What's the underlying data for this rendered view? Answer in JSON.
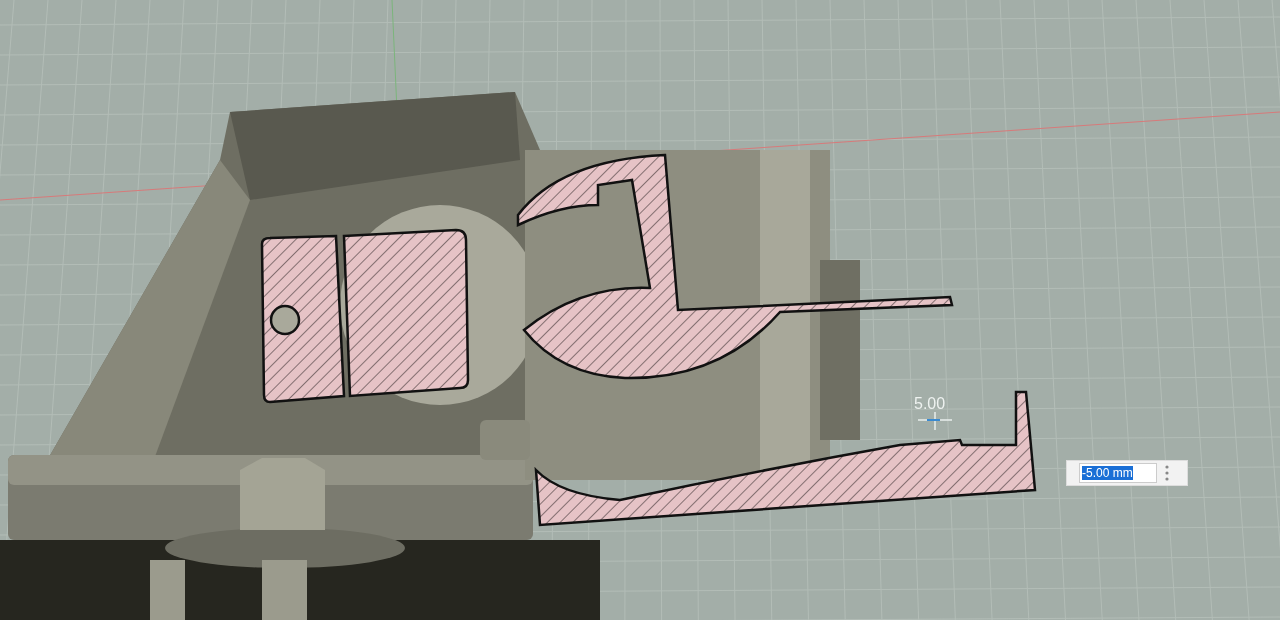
{
  "viewport": {
    "dimension_label": "5.00"
  },
  "value_input": {
    "value": "-5.00 mm",
    "text_selected": true
  }
}
